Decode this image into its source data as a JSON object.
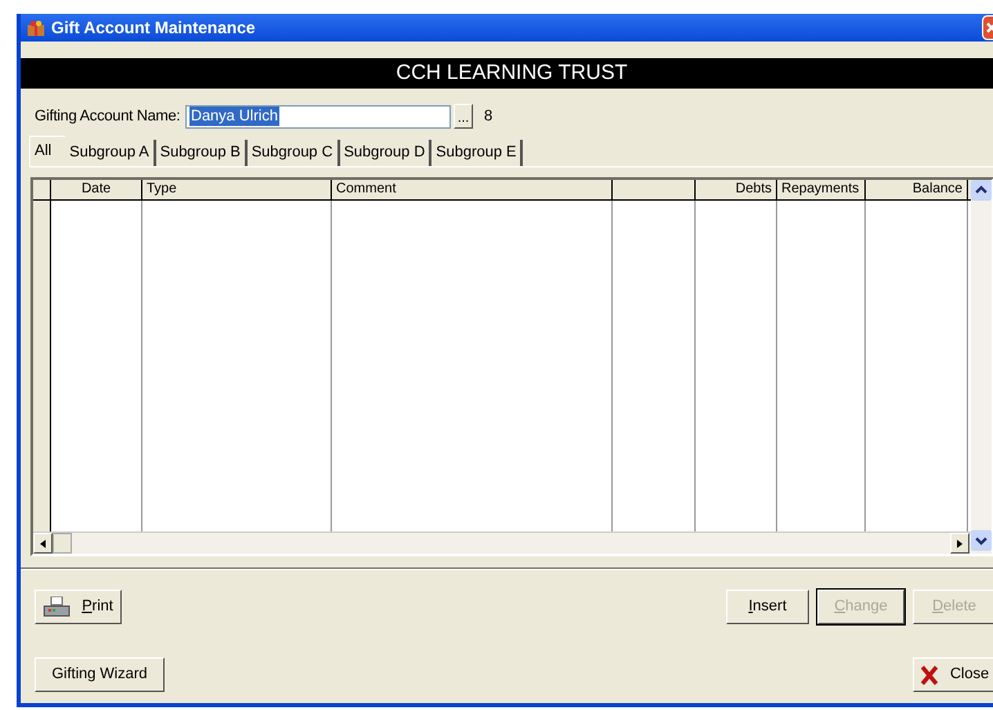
{
  "window": {
    "title": "Gift Account Maintenance"
  },
  "banner": "CCH LEARNING TRUST",
  "account": {
    "label": "Gifting Account Name:",
    "value": "Danya Ulrich",
    "browse": "...",
    "count": "8"
  },
  "tabs": [
    {
      "label": "All",
      "selected": true
    },
    {
      "label": "Subgroup A",
      "selected": false
    },
    {
      "label": "Subgroup B",
      "selected": false
    },
    {
      "label": "Subgroup C",
      "selected": false
    },
    {
      "label": "Subgroup D",
      "selected": false
    },
    {
      "label": "Subgroup E",
      "selected": false
    }
  ],
  "table": {
    "columns": [
      "Date",
      "Type",
      "Comment",
      "",
      "Debts",
      "Repayments",
      "Balance"
    ]
  },
  "buttons": [
    {
      "label": "Print",
      "kind": "print",
      "disabled": false,
      "mnemonic": true
    },
    {
      "label": "Insert",
      "kind": "plain",
      "disabled": false,
      "mnemonic": true
    },
    {
      "label": "Change",
      "kind": "plain",
      "disabled": true,
      "mnemonic": true
    },
    {
      "label": "Delete",
      "kind": "plain",
      "disabled": true,
      "mnemonic": true
    },
    {
      "label": "Gifting Wizard",
      "kind": "plain",
      "disabled": false,
      "mnemonic": false
    },
    {
      "label": "Close",
      "kind": "close",
      "disabled": false,
      "mnemonic": false
    }
  ]
}
